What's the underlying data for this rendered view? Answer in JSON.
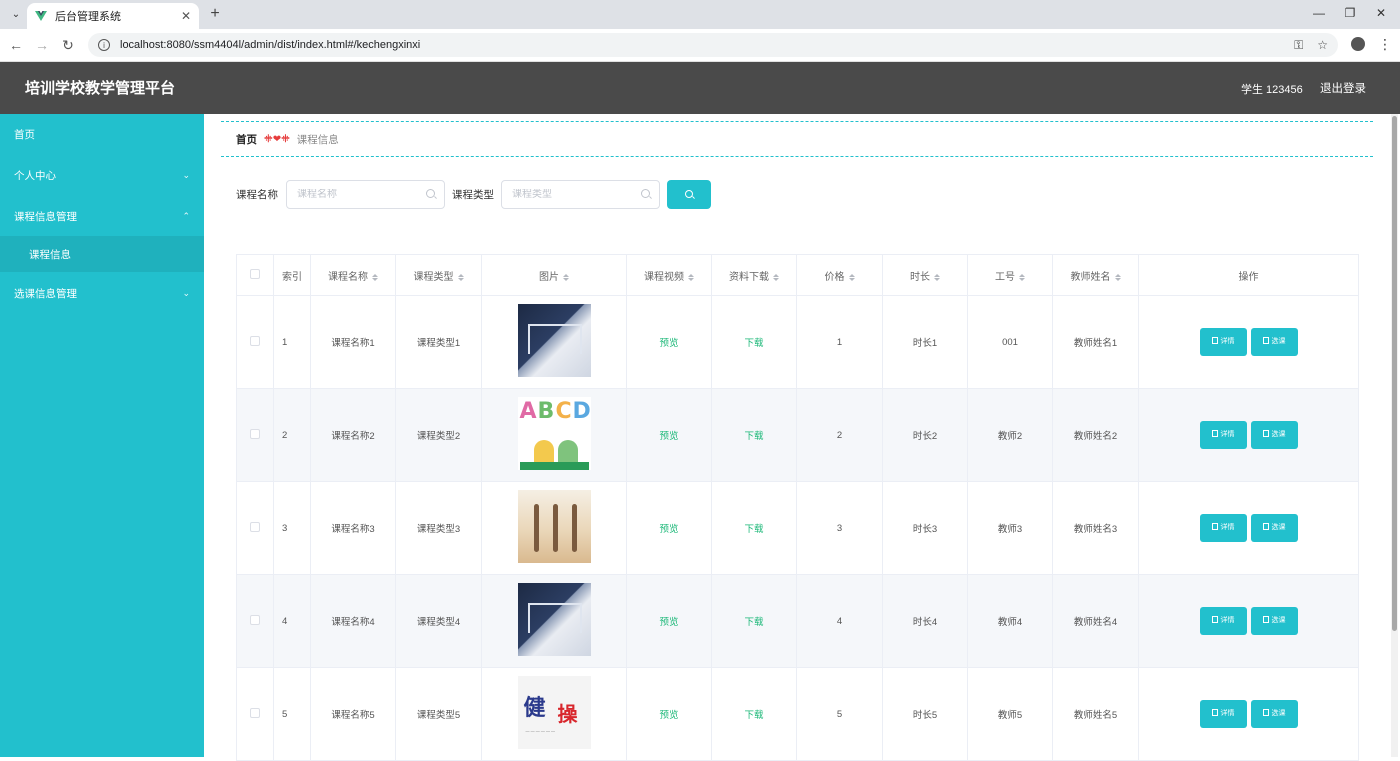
{
  "browser": {
    "tab_title": "后台管理系统",
    "url": "localhost:8080/ssm4404l/admin/dist/index.html#/kechengxinxi"
  },
  "header": {
    "title": "培训学校教学管理平台",
    "user": "学生 123456",
    "logout": "退出登录"
  },
  "sidebar": {
    "items": [
      {
        "label": "首页"
      },
      {
        "label": "个人中心"
      },
      {
        "label": "课程信息管理"
      },
      {
        "label": "选课信息管理"
      }
    ],
    "sub_item": "课程信息"
  },
  "breadcrumb": {
    "home": "首页",
    "separator": "ꔰ❤ꔰ",
    "current": "课程信息"
  },
  "search": {
    "name_label": "课程名称",
    "name_placeholder": "课程名称",
    "type_label": "课程类型",
    "type_placeholder": "课程类型"
  },
  "table": {
    "headers": {
      "index": "索引",
      "name": "课程名称",
      "type": "课程类型",
      "image": "图片",
      "video": "课程视频",
      "download": "资料下载",
      "price": "价格",
      "duration": "时长",
      "staff_id": "工号",
      "teacher": "教师姓名",
      "actions": "操作"
    },
    "rows": [
      {
        "index": "1",
        "name": "课程名称1",
        "type": "课程类型1",
        "image": "study",
        "video": "预览",
        "download": "下载",
        "price": "1",
        "duration": "时长1",
        "staff_id": "001",
        "teacher": "教师姓名1"
      },
      {
        "index": "2",
        "name": "课程名称2",
        "type": "课程类型2",
        "image": "abc",
        "video": "预览",
        "download": "下载",
        "price": "2",
        "duration": "时长2",
        "staff_id": "教师2",
        "teacher": "教师姓名2"
      },
      {
        "index": "3",
        "name": "课程名称3",
        "type": "课程类型3",
        "image": "dance",
        "video": "预览",
        "download": "下载",
        "price": "3",
        "duration": "时长3",
        "staff_id": "教师3",
        "teacher": "教师姓名3"
      },
      {
        "index": "4",
        "name": "课程名称4",
        "type": "课程类型4",
        "image": "study",
        "video": "预览",
        "download": "下载",
        "price": "4",
        "duration": "时长4",
        "staff_id": "教师4",
        "teacher": "教师姓名4"
      },
      {
        "index": "5",
        "name": "课程名称5",
        "type": "课程类型5",
        "image": "fitness",
        "video": "预览",
        "download": "下载",
        "price": "5",
        "duration": "时长5",
        "staff_id": "教师5",
        "teacher": "教师姓名5"
      }
    ],
    "detail_button": "详情",
    "select_button": "选课"
  },
  "colors": {
    "accent": "#22c0cd",
    "header_bg": "#4a4a4a",
    "link_green": "#1fb97a"
  }
}
